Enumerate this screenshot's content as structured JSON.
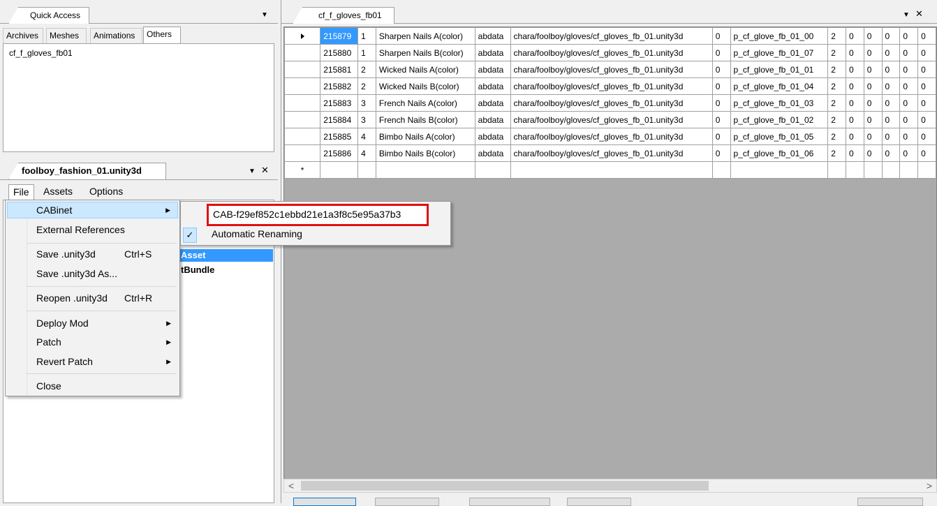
{
  "quick_access": {
    "title": "Quick Access",
    "tabs": [
      "Archives",
      "Meshes",
      "Animations",
      "Others"
    ],
    "active_tab": "Others",
    "items": [
      "cf_f_gloves_fb01"
    ]
  },
  "asset_panel": {
    "title": "foolboy_fashion_01.unity3d",
    "menubar": [
      "File",
      "Assets",
      "Options"
    ],
    "tree_fragments": [
      "Asset",
      "tBundle"
    ]
  },
  "file_menu": {
    "items": [
      {
        "label": "CABinet",
        "shortcut": "",
        "submenu": true
      },
      {
        "label": "External References",
        "shortcut": "",
        "submenu": false
      },
      {
        "label": "Save .unity3d",
        "shortcut": "Ctrl+S",
        "submenu": false
      },
      {
        "label": "Save .unity3d As...",
        "shortcut": "",
        "submenu": false
      },
      {
        "label": "Reopen .unity3d",
        "shortcut": "Ctrl+R",
        "submenu": false
      },
      {
        "label": "Deploy Mod",
        "shortcut": "",
        "submenu": true
      },
      {
        "label": "Patch",
        "shortcut": "",
        "submenu": true
      },
      {
        "label": "Revert Patch",
        "shortcut": "",
        "submenu": true
      },
      {
        "label": "Close",
        "shortcut": "",
        "submenu": false
      }
    ]
  },
  "cabinet_submenu": {
    "cab_name": "CAB-f29ef852c1ebbd21e1a3f8c5e95a37b3",
    "auto_rename_label": "Automatic Renaming",
    "check_glyph": "✓"
  },
  "editor": {
    "tab_title": "cf_f_gloves_fb01",
    "rows": [
      [
        "215879",
        "1",
        "Sharpen Nails A(color)",
        "abdata",
        "chara/foolboy/gloves/cf_gloves_fb_01.unity3d",
        "0",
        "p_cf_glove_fb_01_00",
        "2",
        "0",
        "0",
        "0",
        "0",
        "0"
      ],
      [
        "215880",
        "1",
        "Sharpen Nails B(color)",
        "abdata",
        "chara/foolboy/gloves/cf_gloves_fb_01.unity3d",
        "0",
        "p_cf_glove_fb_01_07",
        "2",
        "0",
        "0",
        "0",
        "0",
        "0"
      ],
      [
        "215881",
        "2",
        "Wicked Nails A(color)",
        "abdata",
        "chara/foolboy/gloves/cf_gloves_fb_01.unity3d",
        "0",
        "p_cf_glove_fb_01_01",
        "2",
        "0",
        "0",
        "0",
        "0",
        "0"
      ],
      [
        "215882",
        "2",
        "Wicked Nails B(color)",
        "abdata",
        "chara/foolboy/gloves/cf_gloves_fb_01.unity3d",
        "0",
        "p_cf_glove_fb_01_04",
        "2",
        "0",
        "0",
        "0",
        "0",
        "0"
      ],
      [
        "215883",
        "3",
        "French Nails A(color)",
        "abdata",
        "chara/foolboy/gloves/cf_gloves_fb_01.unity3d",
        "0",
        "p_cf_glove_fb_01_03",
        "2",
        "0",
        "0",
        "0",
        "0",
        "0"
      ],
      [
        "215884",
        "3",
        "French Nails B(color)",
        "abdata",
        "chara/foolboy/gloves/cf_gloves_fb_01.unity3d",
        "0",
        "p_cf_glove_fb_01_02",
        "2",
        "0",
        "0",
        "0",
        "0",
        "0"
      ],
      [
        "215885",
        "4",
        "Bimbo Nails A(color)",
        "abdata",
        "chara/foolboy/gloves/cf_gloves_fb_01.unity3d",
        "0",
        "p_cf_glove_fb_01_05",
        "2",
        "0",
        "0",
        "0",
        "0",
        "0"
      ],
      [
        "215886",
        "4",
        "Bimbo Nails B(color)",
        "abdata",
        "chara/foolboy/gloves/cf_gloves_fb_01.unity3d",
        "0",
        "p_cf_glove_fb_01_06",
        "2",
        "0",
        "0",
        "0",
        "0",
        "0"
      ]
    ],
    "new_row_marker": "*"
  },
  "icons": {
    "dropdown": "▼",
    "close": "✕",
    "submenu_arrow": "▶",
    "row_current": "▸",
    "scroll_left": "<",
    "scroll_right": ">"
  },
  "colors": {
    "selection": "#3399ff",
    "menu_highlight": "#cce8ff",
    "annotation_box": "#e01010",
    "grid_background": "#ababab"
  }
}
